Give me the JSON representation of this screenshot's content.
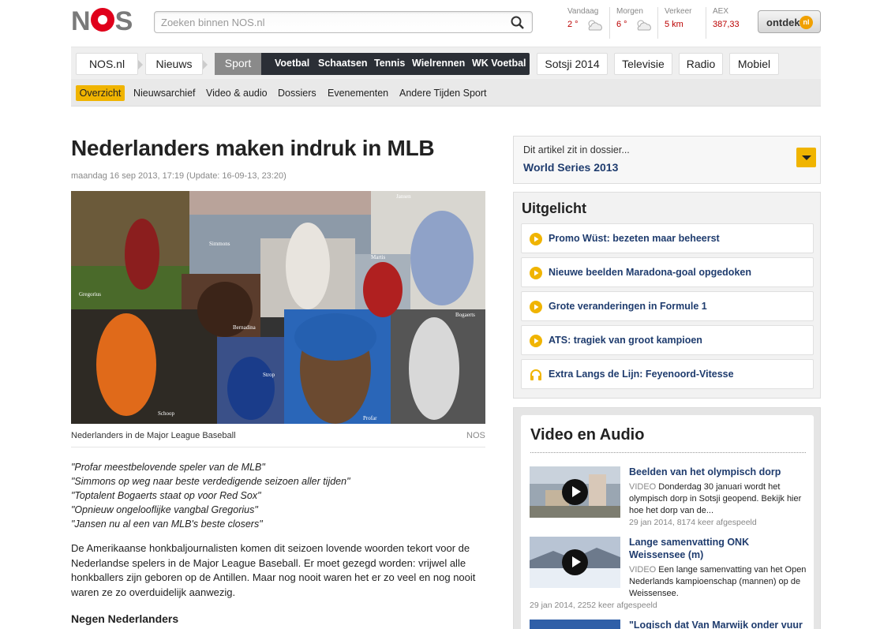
{
  "logo": "NOS",
  "search": {
    "placeholder": "Zoeken binnen NOS.nl"
  },
  "weather": [
    {
      "label": "Vandaag",
      "value": "2 °"
    },
    {
      "label": "Morgen",
      "value": "6 °"
    },
    {
      "label": "Verkeer",
      "value": "5 km"
    },
    {
      "label": "AEX",
      "value": "387,33"
    }
  ],
  "ontdek": {
    "label": "ontdek",
    "badge": "nl"
  },
  "nav": {
    "items": [
      "NOS.nl",
      "Nieuws",
      "Sport"
    ],
    "sport_sub": [
      "Voetbal",
      "Schaatsen",
      "Tennis",
      "Wielrennen",
      "WK Voetbal"
    ],
    "extra": [
      "Sotsji 2014",
      "Televisie",
      "Radio",
      "Mobiel"
    ]
  },
  "subnav": {
    "active": "Overzicht",
    "items": [
      "Nieuwsarchief",
      "Video & audio",
      "Dossiers",
      "Evenementen",
      "Andere Tijden Sport"
    ]
  },
  "article": {
    "title": "Nederlanders maken indruk in MLB",
    "date": "maandag 16 sep 2013, 17:19 (Update: 16-09-13, 23:20)",
    "photo_labels": [
      "Gregorius",
      "Simmons",
      "Jansen",
      "Martis",
      "Bernadina",
      "Bogaerts",
      "Strop",
      "Schoop",
      "Profar"
    ],
    "caption": "Nederlanders in de Major League Baseball",
    "credit": "NOS",
    "quotes": [
      "\"Profar meestbelovende speler van de MLB\"",
      "\"Simmons op weg naar beste verdedigende seizoen aller tijden\"",
      "\"Toptalent Bogaerts staat op voor Red Sox\"",
      "\"Opnieuw ongelooflijke vangbal Gregorius\"",
      "\"Jansen nu al een van MLB's beste closers\""
    ],
    "body": "De Amerikaanse honkbaljournalisten komen dit seizoen lovende woorden tekort voor de Nederlandse spelers in de Major League Baseball. Er moet gezegd worden: vrijwel alle honkballers zijn geboren op de Antillen. Maar nog nooit waren het er zo veel en nog nooit waren ze zo overduidelijk aanwezig.",
    "subheading": "Negen Nederlanders"
  },
  "dossier": {
    "intro": "Dit artikel zit in dossier...",
    "name": "World Series 2013"
  },
  "uitgelicht": {
    "title": "Uitgelicht",
    "items": [
      {
        "label": "Promo Wüst: bezeten maar beheerst",
        "icon": "play-icon"
      },
      {
        "label": "Nieuwe beelden Maradona-goal opgedoken",
        "icon": "play-icon"
      },
      {
        "label": "Grote veranderingen in Formule 1",
        "icon": "play-icon"
      },
      {
        "label": "ATS: tragiek van groot kampioen",
        "icon": "play-icon"
      },
      {
        "label": "Extra Langs de Lijn: Feyenoord-Vitesse",
        "icon": "headphones-icon"
      }
    ]
  },
  "video": {
    "title": "Video en Audio",
    "items": [
      {
        "title": "Beelden van het olympisch dorp",
        "tag": "VIDEO",
        "desc": "Donderdag 30 januari wordt het olympisch dorp in Sotsji geopend. Bekijk hier hoe het dorp van de...",
        "meta": "29 jan 2014, 8174 keer afgespeeld"
      },
      {
        "title": "Lange samenvatting ONK Weissensee (m)",
        "tag": "VIDEO",
        "desc": "Een lange samenvatting van het Open Nederlands kampioenschap (mannen) op de Weissensee.",
        "meta": "29 jan 2014, 2252 keer afgespeeld"
      },
      {
        "title": "\"Logisch dat Van Marwijk onder vuur"
      }
    ]
  },
  "colors": {
    "brand": "#e0001b",
    "accent": "#f0b400",
    "link": "#1f3c6e",
    "sportbar": "#2b2f36"
  }
}
